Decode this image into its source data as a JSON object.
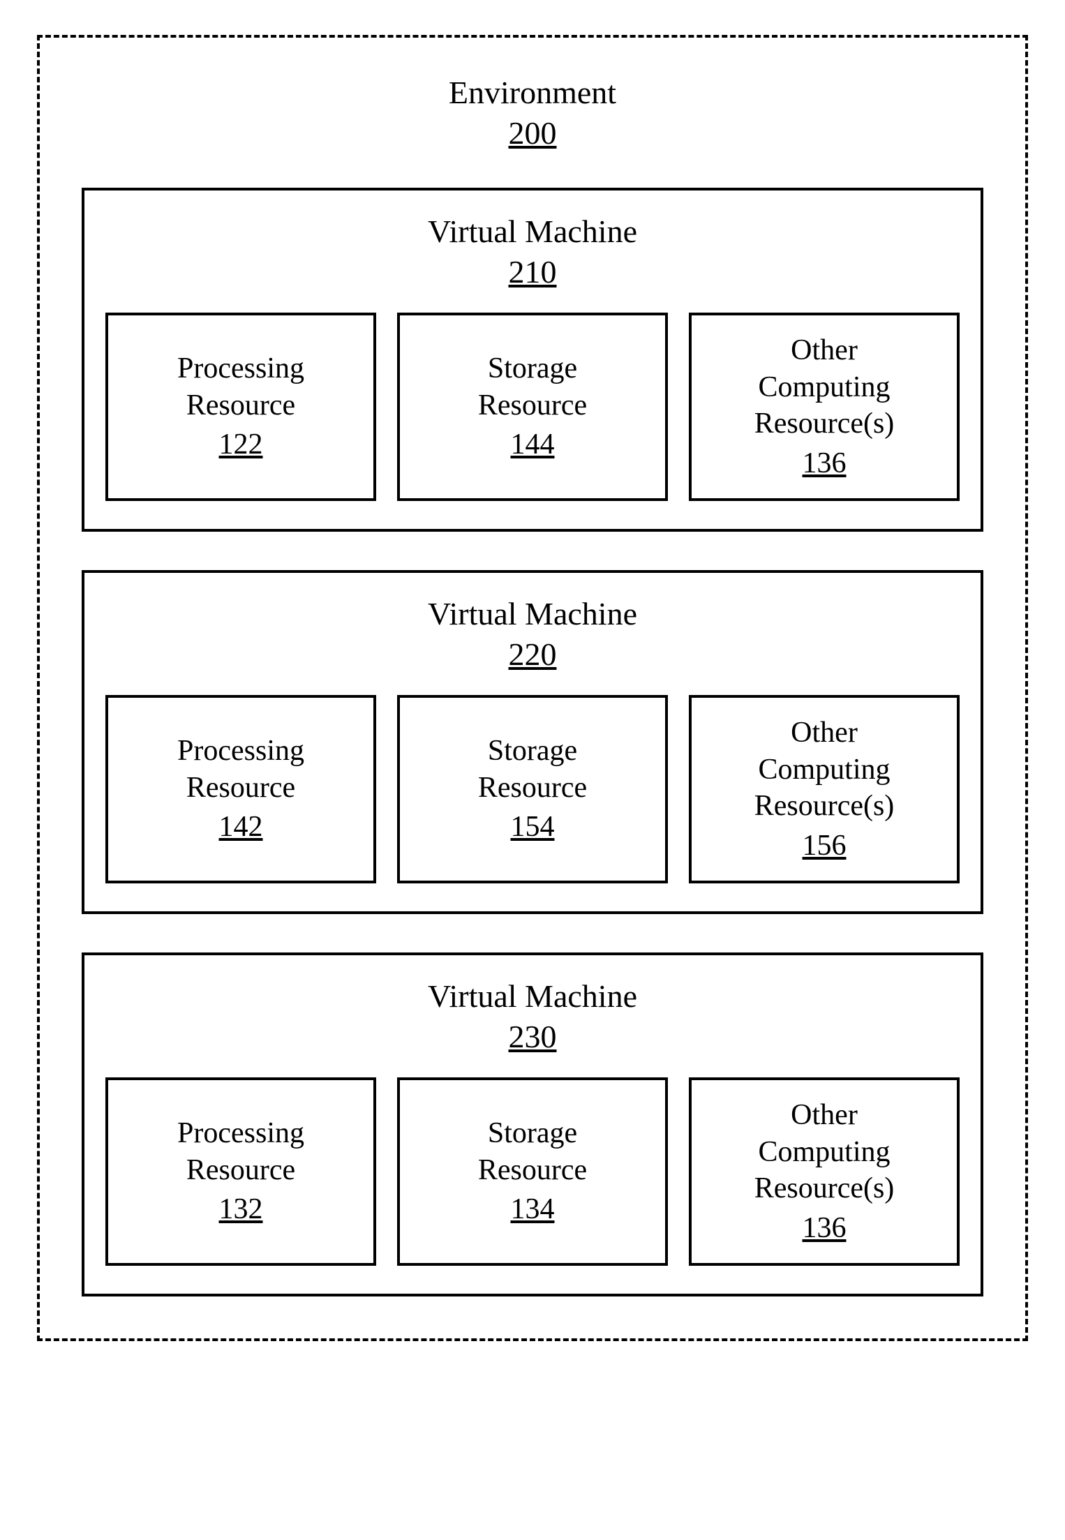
{
  "environment": {
    "title": "Environment",
    "ref": "200",
    "vms": [
      {
        "title": "Virtual Machine",
        "ref": "210",
        "resources": [
          {
            "line1": "Processing",
            "line2": "Resource",
            "ref": "122"
          },
          {
            "line1": "Storage",
            "line2": "Resource",
            "ref": "144"
          },
          {
            "line1": "Other",
            "line2": "Computing",
            "line3": "Resource(s)",
            "ref": "136"
          }
        ]
      },
      {
        "title": "Virtual Machine",
        "ref": "220",
        "resources": [
          {
            "line1": "Processing",
            "line2": "Resource",
            "ref": "142"
          },
          {
            "line1": "Storage",
            "line2": "Resource",
            "ref": "154"
          },
          {
            "line1": "Other",
            "line2": "Computing",
            "line3": "Resource(s)",
            "ref": "156"
          }
        ]
      },
      {
        "title": "Virtual Machine",
        "ref": "230",
        "resources": [
          {
            "line1": "Processing",
            "line2": "Resource",
            "ref": "132"
          },
          {
            "line1": "Storage",
            "line2": "Resource",
            "ref": "134"
          },
          {
            "line1": "Other",
            "line2": "Computing",
            "line3": "Resource(s)",
            "ref": "136"
          }
        ]
      }
    ]
  }
}
